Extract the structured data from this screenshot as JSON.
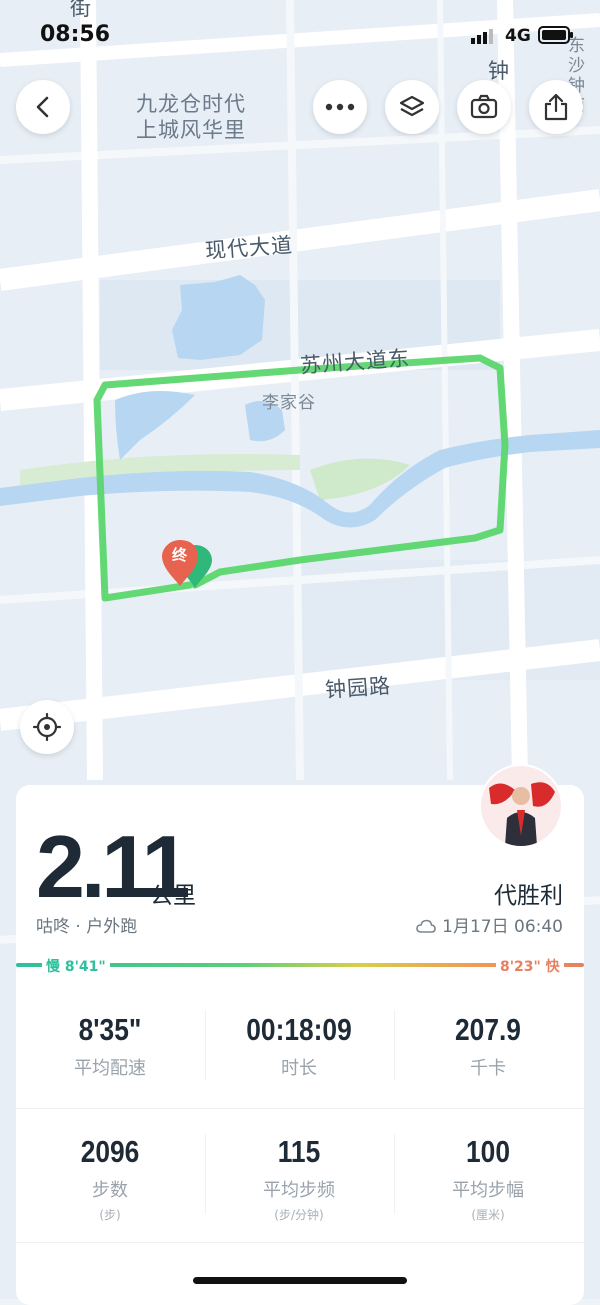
{
  "status_bar": {
    "time": "08:56",
    "network": "4G"
  },
  "map": {
    "labels": {
      "top_left_line1": "九龙仓时代",
      "top_left_line2": "上城风华里",
      "road_modern": "现代大道",
      "road_suzhou": "苏州大道东",
      "place_lijiagu": "李家谷",
      "road_zhongyuan": "钟园路",
      "top_right_char": "钟",
      "top_right_edge": "东沙 钟南",
      "top_left_char": "街",
      "end_marker": "终"
    }
  },
  "summary": {
    "distance": "2.11",
    "distance_unit": "公里",
    "activity": "咕咚 · 户外跑",
    "user_name": "代胜利",
    "date": "1月17日 06:40"
  },
  "pace_bar": {
    "slow_label": "慢 8'41\"",
    "fast_label": "8'23\" 快"
  },
  "stats_row1": [
    {
      "value": "8'35\"",
      "label": "平均配速"
    },
    {
      "value": "00:18:09",
      "label": "时长"
    },
    {
      "value": "207.9",
      "label": "千卡"
    }
  ],
  "stats_row2": [
    {
      "value": "2096",
      "label": "步数",
      "unit": "(步)"
    },
    {
      "value": "115",
      "label": "平均步频",
      "unit": "(步/分钟)"
    },
    {
      "value": "100",
      "label": "平均步幅",
      "unit": "(厘米)"
    }
  ],
  "colors": {
    "route": "#5bd66d",
    "pace_slow": "#2fbf9c",
    "pace_fast": "#e68060"
  }
}
